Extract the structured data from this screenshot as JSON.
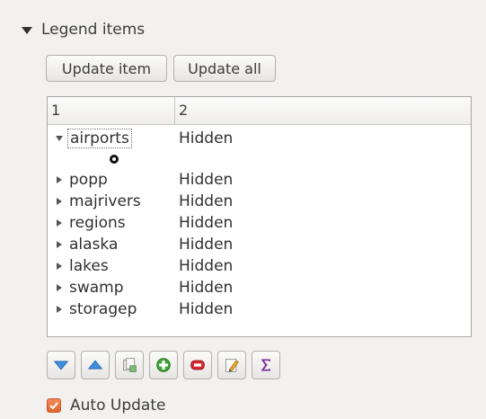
{
  "section": {
    "title": "Legend items"
  },
  "buttons": {
    "update_item": "Update item",
    "update_all": "Update all"
  },
  "tree": {
    "columns": [
      "1",
      "2"
    ],
    "rows": [
      {
        "name": "airports",
        "value": "Hidden",
        "expanded": true
      },
      {
        "name": "popp",
        "value": "Hidden",
        "expanded": false
      },
      {
        "name": "majrivers",
        "value": "Hidden",
        "expanded": false
      },
      {
        "name": "regions",
        "value": "Hidden",
        "expanded": false
      },
      {
        "name": "alaska",
        "value": "Hidden",
        "expanded": false
      },
      {
        "name": "lakes",
        "value": "Hidden",
        "expanded": false
      },
      {
        "name": "swamp",
        "value": "Hidden",
        "expanded": false
      },
      {
        "name": "storagep",
        "value": "Hidden",
        "expanded": false
      }
    ]
  },
  "toolbar": {
    "icons": [
      "move-down-icon",
      "move-up-icon",
      "add-group-icon",
      "add-item-icon",
      "remove-item-icon",
      "edit-item-icon",
      "count-features-icon"
    ]
  },
  "auto_update": {
    "label": "Auto Update",
    "checked": true
  },
  "colors": {
    "accent": "#e8703a",
    "blue": "#3f8fe0",
    "green": "#3aa335",
    "red": "#d8262f",
    "purple": "#7a2e9a"
  }
}
